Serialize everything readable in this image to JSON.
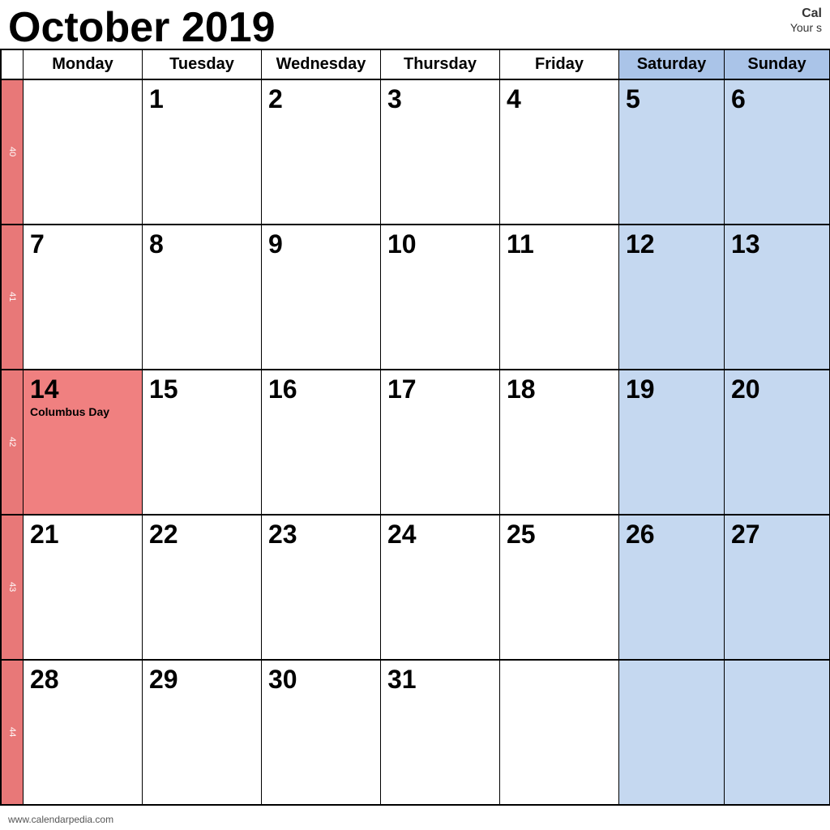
{
  "header": {
    "month_year": "October 2019",
    "month_partial": "ober 2019",
    "calendar_title": "Cal",
    "calendar_subtitle": "Your s"
  },
  "days_of_week": [
    {
      "label": "Monday",
      "weekend": false
    },
    {
      "label": "Tuesday",
      "weekend": false
    },
    {
      "label": "Wednesday",
      "weekend": false
    },
    {
      "label": "Thursday",
      "weekend": false
    },
    {
      "label": "Friday",
      "weekend": false
    },
    {
      "label": "Saturday",
      "weekend": true
    },
    {
      "label": "Sunday",
      "weekend": true
    }
  ],
  "weeks": [
    {
      "week_number": "40",
      "days": [
        {
          "number": "",
          "holiday": "",
          "type": "empty"
        },
        {
          "number": "1",
          "holiday": "",
          "type": "normal"
        },
        {
          "number": "2",
          "holiday": "",
          "type": "normal"
        },
        {
          "number": "3",
          "holiday": "",
          "type": "normal"
        },
        {
          "number": "4",
          "holiday": "",
          "type": "normal"
        },
        {
          "number": "5",
          "holiday": "",
          "type": "weekend"
        },
        {
          "number": "6",
          "holiday": "",
          "type": "weekend"
        }
      ]
    },
    {
      "week_number": "41",
      "days": [
        {
          "number": "7",
          "holiday": "",
          "type": "normal"
        },
        {
          "number": "8",
          "holiday": "",
          "type": "normal"
        },
        {
          "number": "9",
          "holiday": "",
          "type": "normal"
        },
        {
          "number": "10",
          "holiday": "",
          "type": "normal"
        },
        {
          "number": "11",
          "holiday": "",
          "type": "normal"
        },
        {
          "number": "12",
          "holiday": "",
          "type": "weekend"
        },
        {
          "number": "13",
          "holiday": "",
          "type": "weekend"
        }
      ]
    },
    {
      "week_number": "42",
      "days": [
        {
          "number": "14",
          "holiday": "Columbus Day",
          "type": "holiday"
        },
        {
          "number": "15",
          "holiday": "",
          "type": "normal"
        },
        {
          "number": "16",
          "holiday": "",
          "type": "normal"
        },
        {
          "number": "17",
          "holiday": "",
          "type": "normal"
        },
        {
          "number": "18",
          "holiday": "",
          "type": "normal"
        },
        {
          "number": "19",
          "holiday": "",
          "type": "weekend"
        },
        {
          "number": "20",
          "holiday": "",
          "type": "weekend"
        }
      ]
    },
    {
      "week_number": "43",
      "days": [
        {
          "number": "21",
          "holiday": "",
          "type": "normal"
        },
        {
          "number": "22",
          "holiday": "",
          "type": "normal"
        },
        {
          "number": "23",
          "holiday": "",
          "type": "normal"
        },
        {
          "number": "24",
          "holiday": "",
          "type": "normal"
        },
        {
          "number": "25",
          "holiday": "",
          "type": "normal"
        },
        {
          "number": "26",
          "holiday": "",
          "type": "weekend"
        },
        {
          "number": "27",
          "holiday": "",
          "type": "weekend"
        }
      ]
    },
    {
      "week_number": "44",
      "days": [
        {
          "number": "28",
          "holiday": "",
          "type": "normal"
        },
        {
          "number": "29",
          "holiday": "",
          "type": "normal"
        },
        {
          "number": "30",
          "holiday": "",
          "type": "normal"
        },
        {
          "number": "31",
          "holiday": "",
          "type": "normal"
        },
        {
          "number": "",
          "holiday": "",
          "type": "empty"
        },
        {
          "number": "",
          "holiday": "",
          "type": "weekend-empty"
        },
        {
          "number": "",
          "holiday": "",
          "type": "weekend-empty"
        }
      ]
    }
  ],
  "footer": {
    "url": "www.calendarpedia.com"
  }
}
